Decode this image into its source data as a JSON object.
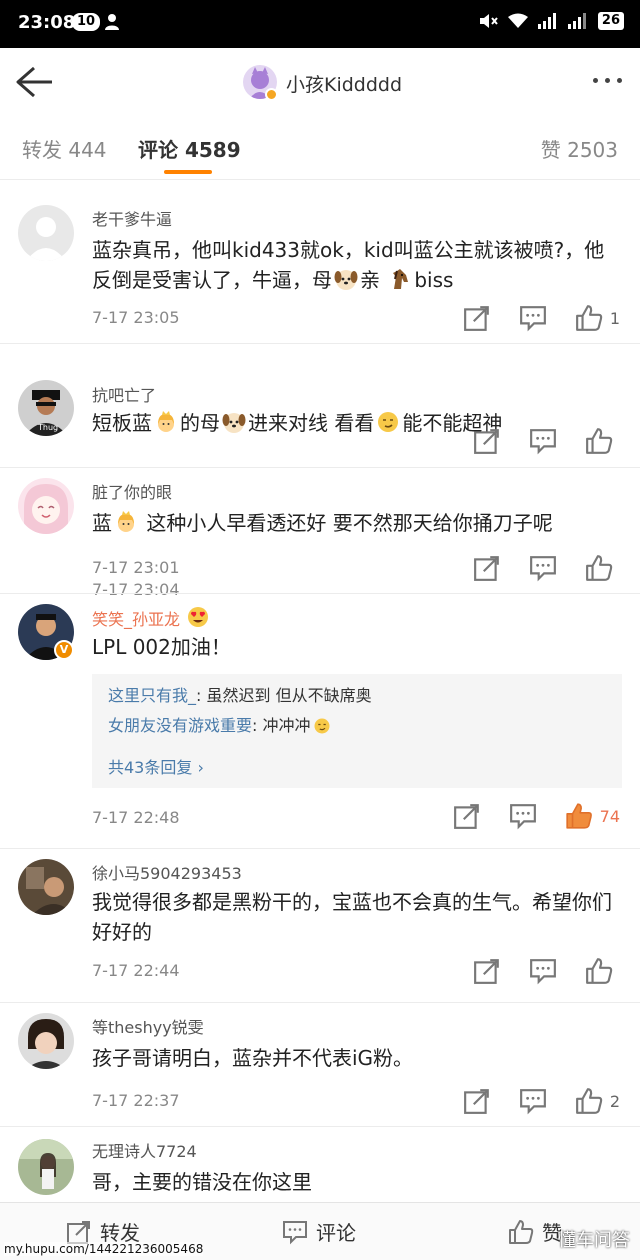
{
  "statusbar": {
    "time": "23:08",
    "badge": "10",
    "battery": "26"
  },
  "header": {
    "title": "小孩Kiddddd"
  },
  "tabs": {
    "forward": "转发 444",
    "comment": "评论 4589",
    "like": "赞 2503"
  },
  "comments": [
    {
      "name": "老干爹牛逼",
      "text_a": "蓝杂真吊，他叫kid433就ok，kid叫蓝公主就该被喷?，他反倒是受害认了，牛逼，母",
      "emoji1": "dog",
      "text_b": "亲",
      "emoji2": "horse",
      "text_c": "biss",
      "time": "7-17 23:05",
      "likes": "1"
    },
    {
      "name": "抗吧亡了",
      "text_a": "短板蓝",
      "emoji1": "princess",
      "text_b": "的母",
      "emoji2": "dog",
      "text_c": "进来对线 看看",
      "emoji3": "smirk",
      "text_d": "能不能超神",
      "time": "7-17 23:04",
      "likes": ""
    },
    {
      "name": "脏了你的眼",
      "text_a": "蓝",
      "emoji1": "princess",
      "text_b": " 这种小人早看透还好 要不然那天给你捅刀子呢",
      "time": "7-17 23:01",
      "likes": ""
    },
    {
      "name": "笑笑_孙亚龙",
      "text": "LPL 002加油！",
      "time": "7-17 22:48",
      "likes": "74",
      "verified": "V",
      "replies": [
        {
          "name": "这里只有我_",
          "text": ": 虽然迟到 但从不缺席奥"
        },
        {
          "name": "女朋友没有游戏重要",
          "text": ": 冲冲冲"
        }
      ],
      "more": "共43条回复 ›"
    },
    {
      "name": "徐小马5904293453",
      "text": "我觉得很多都是黑粉干的，宝蓝也不会真的生气。希望你们好好的",
      "time": "7-17 22:44",
      "likes": ""
    },
    {
      "name": "等theshyy锐雯",
      "text": "孩子哥请明白，蓝杂并不代表iG粉。",
      "time": "7-17 22:37",
      "likes": "2"
    },
    {
      "name": "无理诗人7724",
      "text": "哥，主要的错没在你这里",
      "time": "",
      "likes": ""
    }
  ],
  "bottombar": {
    "forward": "转发",
    "comment": "评论",
    "like": "赞"
  },
  "watermark": "my.hupu.com/144221236005468",
  "watermark_right": "懂车问答",
  "colors": {
    "accent": "#ff8200",
    "link": "#4a7baa",
    "orange_name": "#eb7350"
  }
}
